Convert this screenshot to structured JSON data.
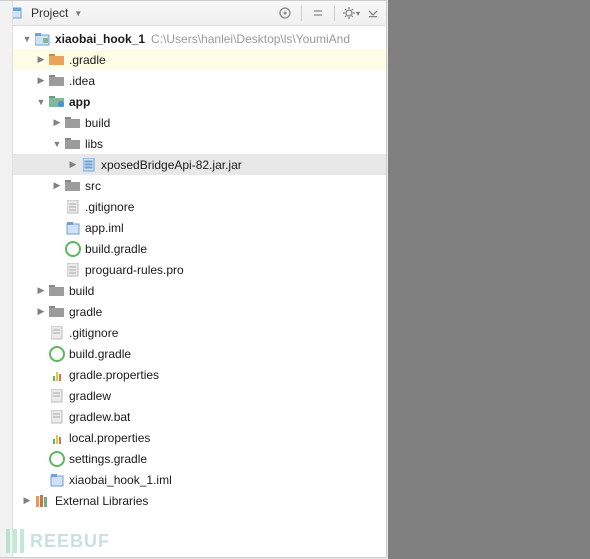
{
  "toolbar": {
    "title": "Project"
  },
  "root": {
    "name": "xiaobai_hook_1",
    "path": "C:\\Users\\hanlei\\Desktop\\ls\\YoumiAnd"
  },
  "gradleFolder": ".gradle",
  "ideaFolder": ".idea",
  "appFolder": "app",
  "app": {
    "build": "build",
    "libs": "libs",
    "jar": "xposedBridgeApi-82.jar.jar",
    "src": "src",
    "gitignore": ".gitignore",
    "iml": "app.iml",
    "buildgradle": "build.gradle",
    "proguard": "proguard-rules.pro"
  },
  "buildFolder": "build",
  "gradleFolder2": "gradle",
  "gitignore": ".gitignore",
  "buildgradle": "build.gradle",
  "gradleprops": "gradle.properties",
  "gradlew": "gradlew",
  "gradlewbat": "gradlew.bat",
  "localprops": "local.properties",
  "settingsgradle": "settings.gradle",
  "projiml": "xiaobai_hook_1.iml",
  "extlib": "External Libraries",
  "watermark": "REEBUF"
}
